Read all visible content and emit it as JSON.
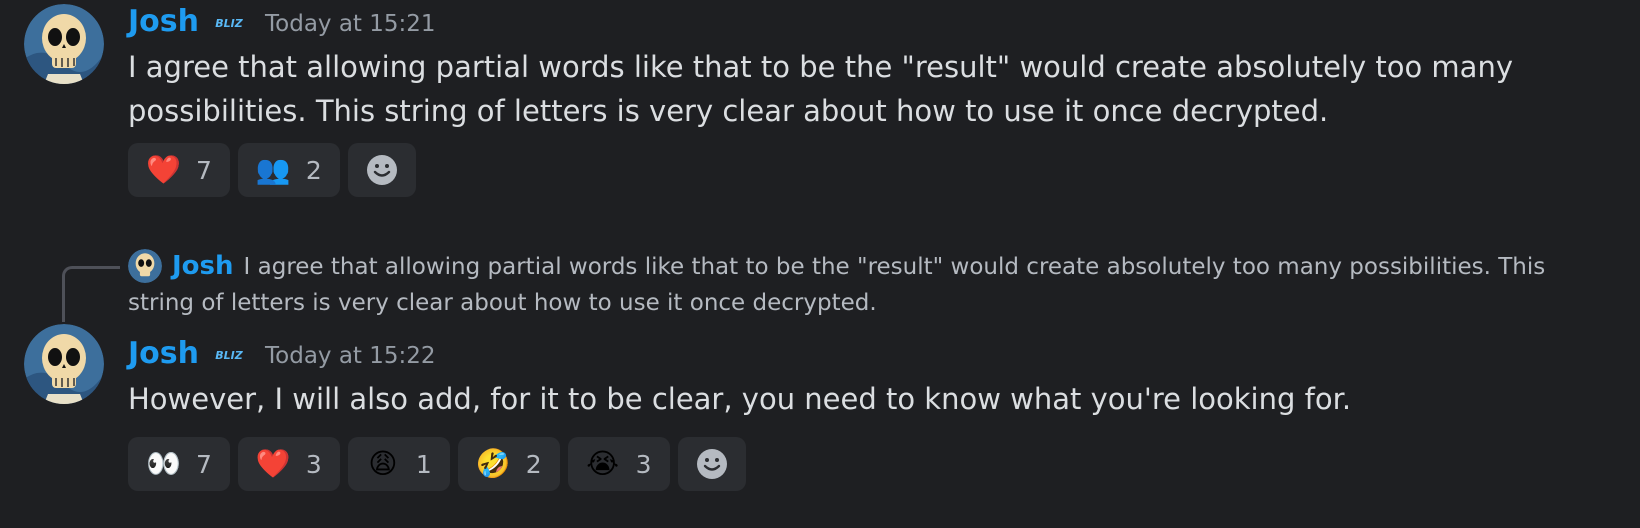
{
  "messages": [
    {
      "username": "Josh",
      "badge_icon": "blizzard-badge",
      "timestamp": "Today at 15:21",
      "text": "I agree that allowing partial words like that to be the \"result\" would create absolutely too many possibilities. This string of letters is very clear about how to use it once decrypted.",
      "reactions": [
        {
          "emoji": "❤️",
          "icon": "heart-emoji",
          "count": "7"
        },
        {
          "emoji": "👥",
          "icon": "people-emoji",
          "count": "2"
        }
      ]
    },
    {
      "username": "Josh",
      "badge_icon": "blizzard-badge",
      "timestamp": "Today at 15:22",
      "reply": {
        "username": "Josh",
        "text": "I agree that allowing partial words like that to be the \"result\" would create absolutely too many possibilities. This string of letters is very clear about how to use it once decrypted."
      },
      "text": "However, I will also add, for it to be clear, you need to know what you're looking for.",
      "reactions": [
        {
          "emoji": "👀",
          "icon": "eyes-emoji",
          "count": "7"
        },
        {
          "emoji": "❤️",
          "icon": "heart-emoji",
          "count": "3"
        },
        {
          "emoji": "😩",
          "icon": "weary-face-emoji",
          "count": "1"
        },
        {
          "emoji": "🤣",
          "icon": "rofl-emoji",
          "count": "2"
        },
        {
          "emoji": "😭",
          "icon": "crying-face-emoji",
          "count": "3"
        }
      ]
    }
  ],
  "colors": {
    "background": "#1e1f22",
    "username": "#1e9bf0",
    "text": "#dbdee1",
    "muted": "#949ba4",
    "reaction_bg": "#2b2d31"
  }
}
